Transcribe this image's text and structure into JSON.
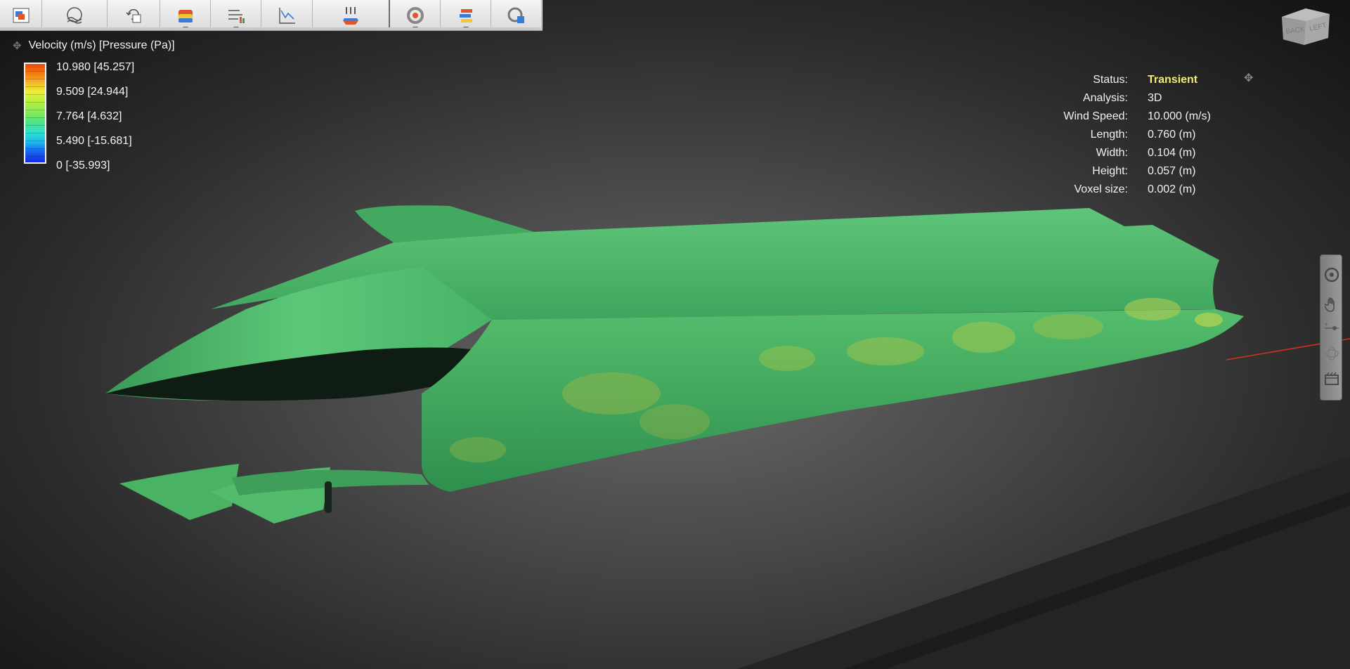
{
  "toolbar": {
    "buttons": [
      {
        "id": "display",
        "icon": "display-settings-icon",
        "has_dropdown": false
      },
      {
        "id": "flow",
        "icon": "flow-wave-icon",
        "has_dropdown": false
      },
      {
        "id": "rotate",
        "icon": "rotate-object-icon",
        "has_dropdown": false
      },
      {
        "id": "surface",
        "icon": "surface-results-icon",
        "has_dropdown": true
      },
      {
        "id": "streamlines",
        "icon": "streamlines-icon",
        "has_dropdown": true
      },
      {
        "id": "plot",
        "icon": "force-plot-icon",
        "has_dropdown": false
      },
      {
        "id": "plane",
        "icon": "flow-plane-icon",
        "has_dropdown": false
      },
      {
        "id": "settings",
        "icon": "target-settings-icon",
        "has_dropdown": true
      },
      {
        "id": "layers",
        "icon": "layers-icon",
        "has_dropdown": true
      },
      {
        "id": "capture",
        "icon": "capture-view-icon",
        "has_dropdown": false
      }
    ]
  },
  "legend": {
    "title": "Velocity (m/s) [Pressure (Pa)]",
    "labels": [
      "10.980 [45.257]",
      "9.509 [24.944]",
      "7.764 [4.632]",
      "5.490 [-15.681]",
      "0 [-35.993]"
    ],
    "colors": {
      "max": "#e84a0c",
      "mid": "#80ec5a",
      "min": "#1428e8"
    }
  },
  "info": {
    "status_label": "Status:",
    "status_value": "Transient",
    "analysis_label": "Analysis:",
    "analysis_value": "3D",
    "wind_label": "Wind Speed:",
    "wind_value": "10.000 (m/s)",
    "length_label": "Length:",
    "length_value": "0.760 (m)",
    "width_label": "Width:",
    "width_value": "0.104 (m)",
    "height_label": "Height:",
    "height_value": "0.057 (m)",
    "voxel_label": "Voxel size:",
    "voxel_value": "0.002 (m)"
  },
  "viewcube": {
    "face_back": "BACK",
    "face_left": "LEFT"
  },
  "navbar": {
    "items": [
      "steering-wheel-icon",
      "pan-hand-icon",
      "zoom-slider-icon",
      "orbit-icon",
      "film-icon"
    ]
  },
  "colors": {
    "status": "#f2ef6a",
    "model_green": "#4fb866"
  }
}
